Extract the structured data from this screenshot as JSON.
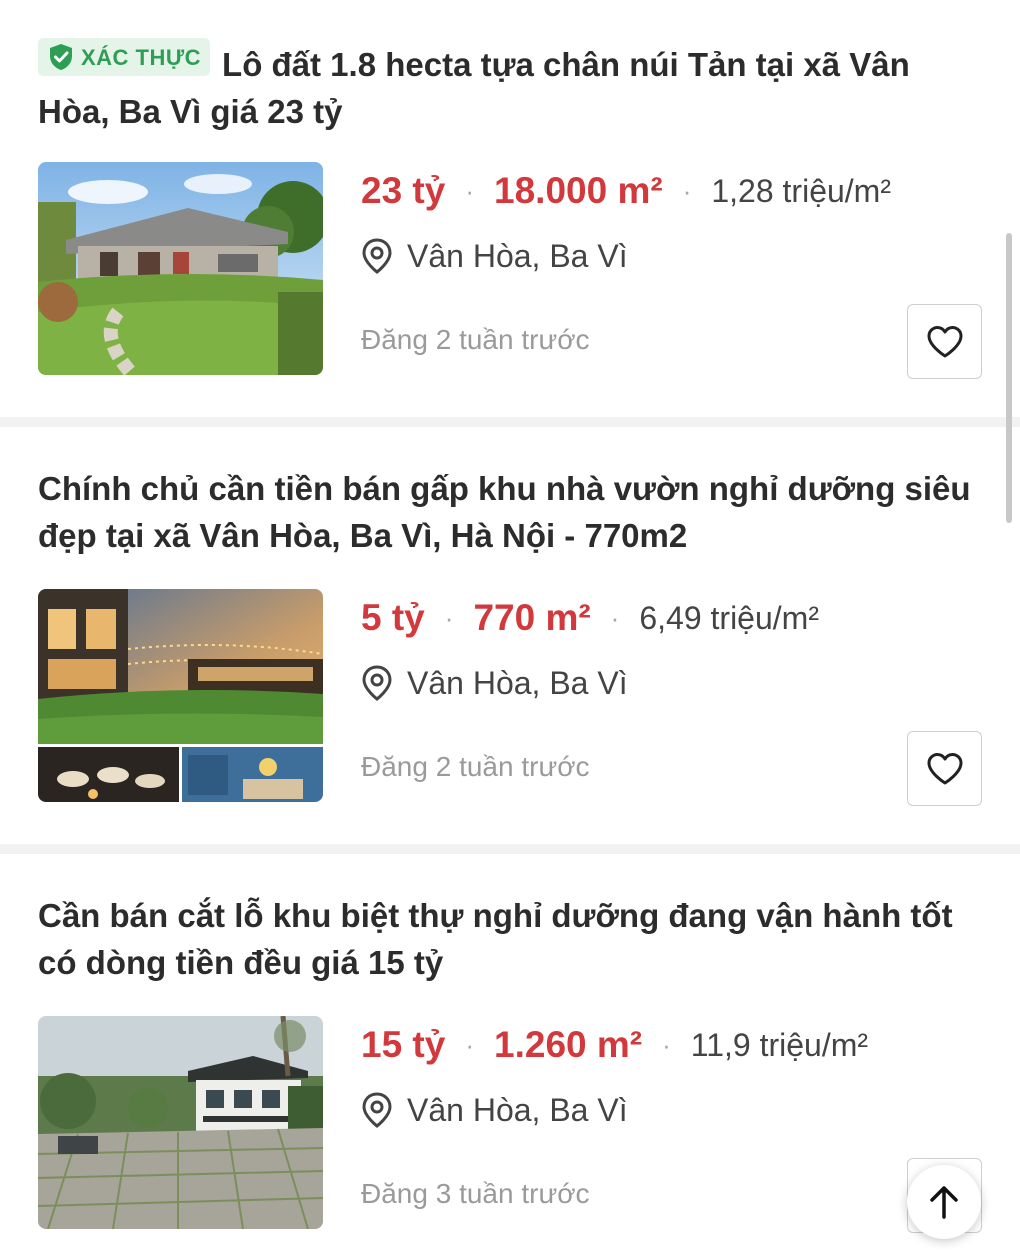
{
  "listings": [
    {
      "badge": "XÁC THỰC",
      "title": "Lô đất 1.8 hecta tựa chân núi Tản tại xã Vân Hòa, Ba Vì giá 23 tỷ",
      "price": "23 tỷ",
      "area": "18.000 m²",
      "price_per_m2": "1,28 triệu/m²",
      "location": "Vân Hòa, Ba Vì",
      "posted": "Đăng 2 tuần trước",
      "image": "garden-house-photo"
    },
    {
      "title": "Chính chủ cần tiền bán gấp khu nhà vườn nghỉ dưỡng siêu đẹp tại xã Vân Hòa, Ba Vì, Hà Nội - 770m2",
      "price": "5 tỷ",
      "area": "770 m²",
      "price_per_m2": "6,49 triệu/m²",
      "location": "Vân Hòa, Ba Vì",
      "posted": "Đăng 2 tuần trước",
      "image": "resort-collage-photo"
    },
    {
      "title": "Cần bán cắt lỗ khu biệt thự nghỉ dưỡng đang vận hành tốt có dòng tiền đều giá 15 tỷ",
      "price": "15 tỷ",
      "area": "1.260 m²",
      "price_per_m2": "11,9 triệu/m²",
      "location": "Vân Hòa, Ba Vì",
      "posted": "Đăng 3 tuần trước",
      "image": "villa-courtyard-photo"
    }
  ],
  "icons": {
    "verified": "shield-check-icon",
    "location": "map-pin-icon",
    "favorite": "heart-icon",
    "back_to_top": "arrow-up-icon"
  },
  "colors": {
    "price": "#d2393d",
    "badge_text": "#2f9e55",
    "badge_bg": "#e4f4e9",
    "muted_text": "#9a9a9a"
  }
}
